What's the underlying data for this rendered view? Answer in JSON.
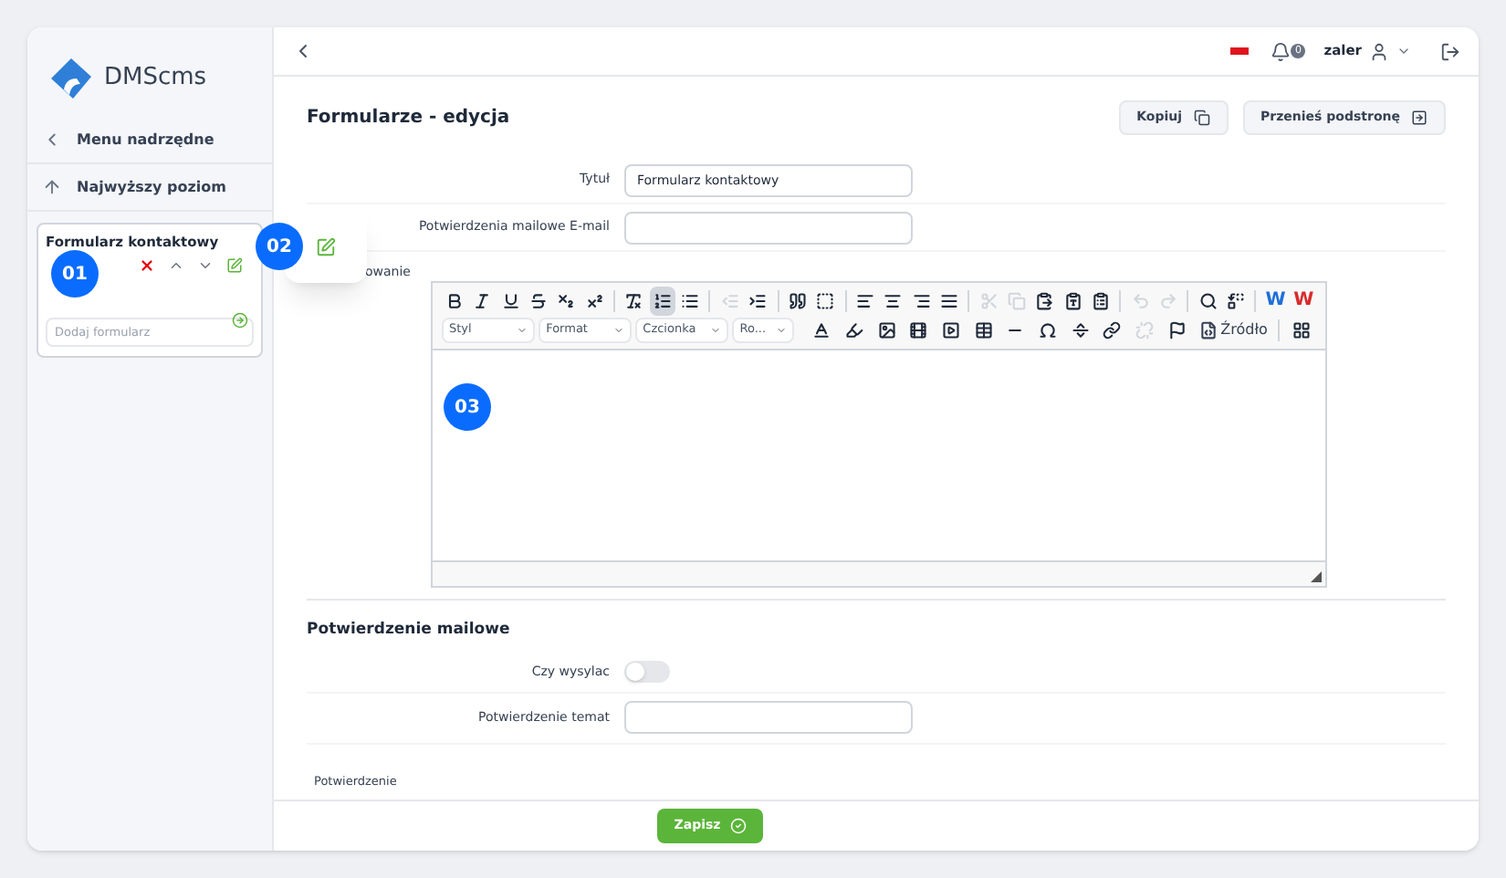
{
  "logo": {
    "text": "DMScms"
  },
  "sidebar": {
    "items": [
      {
        "kind": "back",
        "label": "Menu nadrzędne"
      },
      {
        "kind": "up",
        "label": "Najwyższy poziom"
      }
    ],
    "card": {
      "title": "Formularz kontaktowy",
      "add_field": {
        "placeholder": "Dodaj formularz"
      }
    }
  },
  "annotations": [
    {
      "label": "01"
    },
    {
      "label": "02"
    },
    {
      "label": "03"
    }
  ],
  "header": {
    "notifications": "0",
    "user": "zaler"
  },
  "page": {
    "title": "Formularze - edycja",
    "buttons": [
      {
        "kind": "copy",
        "label": "Kopiuj"
      },
      {
        "kind": "move",
        "label": "Przenieś podstronę"
      }
    ]
  },
  "form": {
    "fields": [
      {
        "label": "Tytuł",
        "value": "Formularz kontaktowy"
      },
      {
        "label": "Potwierdzenia mailowe E-mail"
      }
    ],
    "editor_label": "owanie"
  },
  "toolbar": {
    "row1": [
      {
        "kind": "bold",
        "selected": false,
        "disabled": false
      },
      {
        "kind": "italic",
        "selected": false,
        "disabled": false
      },
      {
        "kind": "underline",
        "selected": false,
        "disabled": false
      },
      {
        "kind": "strike",
        "selected": false,
        "disabled": false
      },
      {
        "kind": "subscript",
        "selected": false,
        "disabled": false
      },
      {
        "kind": "superscript",
        "selected": false,
        "disabled": false
      },
      {
        "kind": "separator"
      },
      {
        "kind": "clear",
        "selected": false,
        "disabled": false
      },
      {
        "kind": "numbered",
        "selected": true,
        "disabled": false
      },
      {
        "kind": "bullets",
        "selected": false,
        "disabled": false
      },
      {
        "kind": "separator"
      },
      {
        "kind": "outdent",
        "selected": false,
        "disabled": true
      },
      {
        "kind": "indent",
        "selected": false,
        "disabled": false
      },
      {
        "kind": "separator"
      },
      {
        "kind": "quote",
        "selected": false,
        "disabled": false
      },
      {
        "kind": "div",
        "selected": false,
        "disabled": false
      },
      {
        "kind": "separator"
      },
      {
        "kind": "left",
        "selected": false,
        "disabled": false
      },
      {
        "kind": "center",
        "selected": false,
        "disabled": false
      },
      {
        "kind": "right",
        "selected": false,
        "disabled": false
      },
      {
        "kind": "justify",
        "selected": false,
        "disabled": false
      },
      {
        "kind": "separator"
      },
      {
        "kind": "cut",
        "selected": false,
        "disabled": true
      },
      {
        "kind": "copy",
        "selected": false,
        "disabled": true
      },
      {
        "kind": "paste",
        "selected": false,
        "disabled": false
      },
      {
        "kind": "pastetext",
        "selected": false,
        "disabled": false
      },
      {
        "kind": "pasteword",
        "selected": false,
        "disabled": false
      },
      {
        "kind": "separator"
      },
      {
        "kind": "undo",
        "selected": false,
        "disabled": true
      },
      {
        "kind": "redo",
        "selected": false,
        "disabled": true
      },
      {
        "kind": "separator"
      },
      {
        "kind": "find",
        "selected": false,
        "disabled": false
      },
      {
        "kind": "replace",
        "selected": false,
        "disabled": false
      },
      {
        "kind": "separator"
      },
      {
        "kind": "letter",
        "label": "W",
        "color": "#1e6fd9"
      },
      {
        "kind": "letter",
        "label": "W",
        "color": "#d92b2b"
      }
    ],
    "dropdowns": [
      "Styl",
      "Format",
      "Czcionka",
      "Ro..."
    ],
    "row2": [
      {
        "kind": "textcolor",
        "disabled": false
      },
      {
        "kind": "bgcolor",
        "disabled": false
      },
      {
        "kind": "image",
        "disabled": false
      },
      {
        "kind": "flash",
        "disabled": false
      },
      {
        "kind": "video",
        "disabled": false
      },
      {
        "kind": "table",
        "disabled": false
      },
      {
        "kind": "hr",
        "disabled": false
      },
      {
        "kind": "omega",
        "disabled": false
      },
      {
        "kind": "pagebreak",
        "disabled": false
      },
      {
        "kind": "link",
        "disabled": false
      },
      {
        "kind": "unlink",
        "disabled": true
      },
      {
        "kind": "anchor",
        "disabled": false
      },
      {
        "kind": "source",
        "label": "Źródło",
        "disabled": false
      },
      {
        "kind": "separator"
      },
      {
        "kind": "blocks",
        "disabled": false
      }
    ]
  },
  "mail_section": {
    "title": "Potwierdzenie mailowe",
    "toggle": {
      "label": "Czy wysylac",
      "on": false
    },
    "subject": {
      "label": "Potwierdzenie temat"
    },
    "editor_label": "Potwierdzenie"
  },
  "footer": {
    "save": "Zapisz"
  }
}
